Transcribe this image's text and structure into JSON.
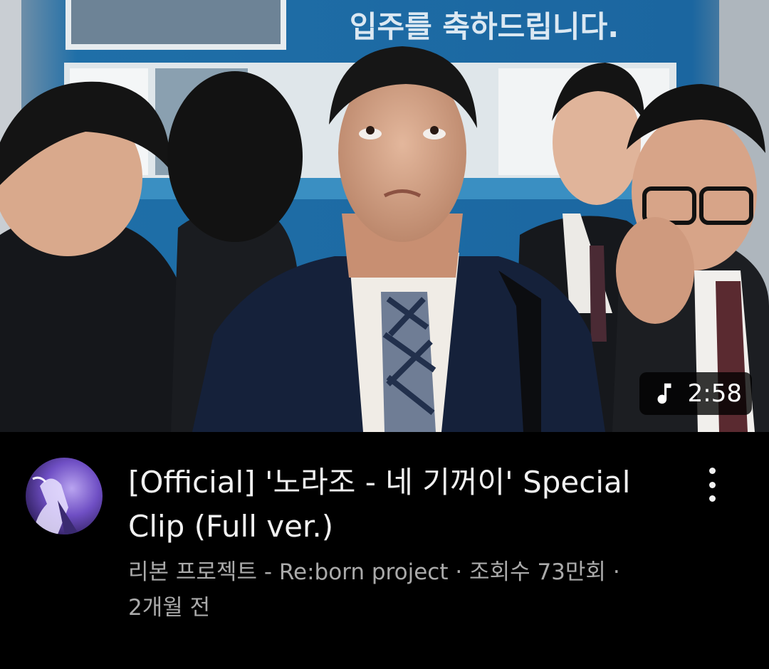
{
  "video": {
    "duration": "2:58",
    "duration_icon": "music-note-icon",
    "banner_text": "입주를 축하드립니다.",
    "title": "[Official] '노라조 - 네 기꺼이' Special Clip (Full ver.)",
    "channel": "리본 프로젝트 - Re:born project",
    "views": "조회수 73만회",
    "age": "2개월 전",
    "separator": "·"
  },
  "menu": {
    "icon": "more-vertical-icon"
  }
}
